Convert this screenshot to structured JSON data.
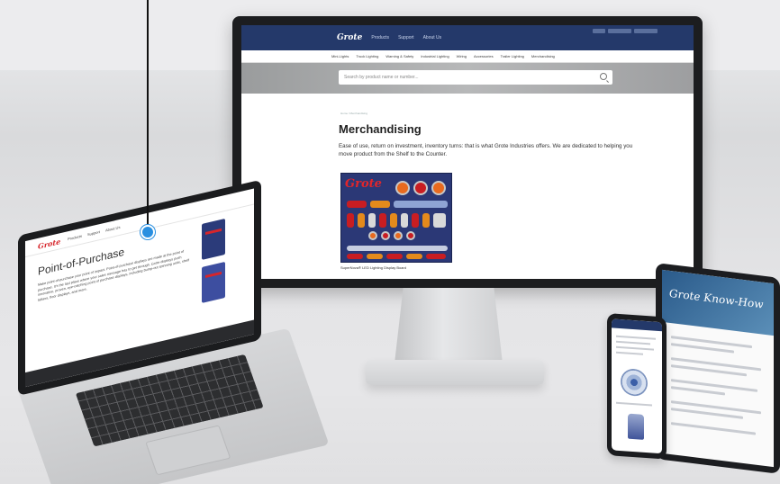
{
  "desktop": {
    "logo": "Grote",
    "nav_items": [
      "Products",
      "Support",
      "About Us"
    ],
    "subnav_items": [
      "Mini-Lights",
      "Truck Lighting",
      "Warning & Safety",
      "Industrial Lighting",
      "Wiring",
      "Accessories",
      "Trailer Lighting",
      "Merchandising"
    ],
    "search_placeholder": "Search by product name or number...",
    "breadcrumb": "Home / Merchandising",
    "page_title": "Merchandising",
    "description": "Ease of use, return on investment, inventory turns: that is what Grote Industries offers. We are dedicated to helping you move product from the Shelf to the Counter.",
    "board_caption": "SuperNova® LED Lighting Display Board",
    "board_logo": "Grote"
  },
  "laptop": {
    "logo": "Grote",
    "nav_items": [
      "Products",
      "Support",
      "About Us"
    ],
    "page_title": "Point-of-Purchase",
    "body_text": "Make point-of-purchase your point of impact. Point-of-purchase displays are made at the point of purchase. It's the last place where your sales message has to get through. Grote displays push innovative, proven, eye-catching point of purchase displays, including bump-out spinning units, shelf talkers, floor displays, and more."
  },
  "tablet": {
    "banner_text": "Grote Know-How"
  },
  "colors": {
    "nav_blue": "#24396a",
    "brand_red": "#d6252b",
    "callout_blue": "#2a8fe0"
  }
}
